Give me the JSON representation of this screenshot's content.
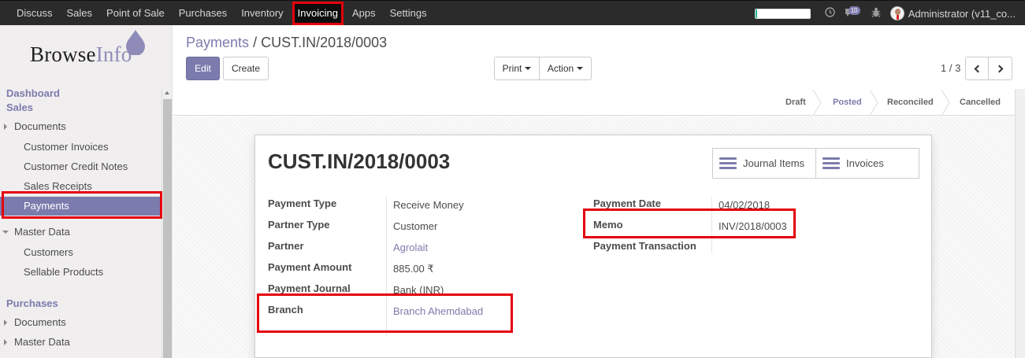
{
  "topbar": {
    "menu": [
      "Discuss",
      "Sales",
      "Point of Sale",
      "Purchases",
      "Inventory",
      "Invoicing",
      "Apps",
      "Settings"
    ],
    "active_menu": "Invoicing",
    "chat_count": "10",
    "username": "Administrator (v11_co..."
  },
  "logo": {
    "part1": "Browse",
    "part2": "Info"
  },
  "sidebar": {
    "dashboard": "Dashboard",
    "sales": "Sales",
    "documents": "Documents",
    "customer_invoices": "Customer Invoices",
    "customer_credit_notes": "Customer Credit Notes",
    "sales_receipts": "Sales Receipts",
    "payments": "Payments",
    "master_data": "Master Data",
    "customers": "Customers",
    "sellable_products": "Sellable Products",
    "purchases": "Purchases",
    "p_documents": "Documents",
    "p_master_data": "Master Data"
  },
  "breadcrumb": {
    "parent": "Payments",
    "separator": "/",
    "current": "CUST.IN/2018/0003"
  },
  "buttons": {
    "edit": "Edit",
    "create": "Create",
    "print": "Print",
    "action": "Action"
  },
  "pager": {
    "value": "1 / 3"
  },
  "statusbar": {
    "stages": [
      "Draft",
      "Posted",
      "Reconciled",
      "Cancelled"
    ],
    "current": "Posted"
  },
  "record": {
    "title": "CUST.IN/2018/0003",
    "smart_buttons": {
      "journal_items": "Journal Items",
      "invoices": "Invoices"
    },
    "left_fields": [
      {
        "label": "Payment Type",
        "value": "Receive Money"
      },
      {
        "label": "Partner Type",
        "value": "Customer"
      },
      {
        "label": "Partner",
        "value": "Agrolait"
      },
      {
        "label": "Payment Amount",
        "value": "885.00 ₹"
      },
      {
        "label": "Payment Journal",
        "value": "Bank (INR)"
      },
      {
        "label": "Branch",
        "value": "Branch Ahemdabad"
      }
    ],
    "right_fields": [
      {
        "label": "Payment Date",
        "value": "04/02/2018"
      },
      {
        "label": "Memo",
        "value": "INV/2018/0003"
      },
      {
        "label": "Payment Transaction",
        "value": ""
      }
    ]
  },
  "colors": {
    "accent": "#7c7bad",
    "highlight": "#e5000c",
    "topbar": "#2b2b2b"
  },
  "progress": {
    "fraction": 0.03
  }
}
